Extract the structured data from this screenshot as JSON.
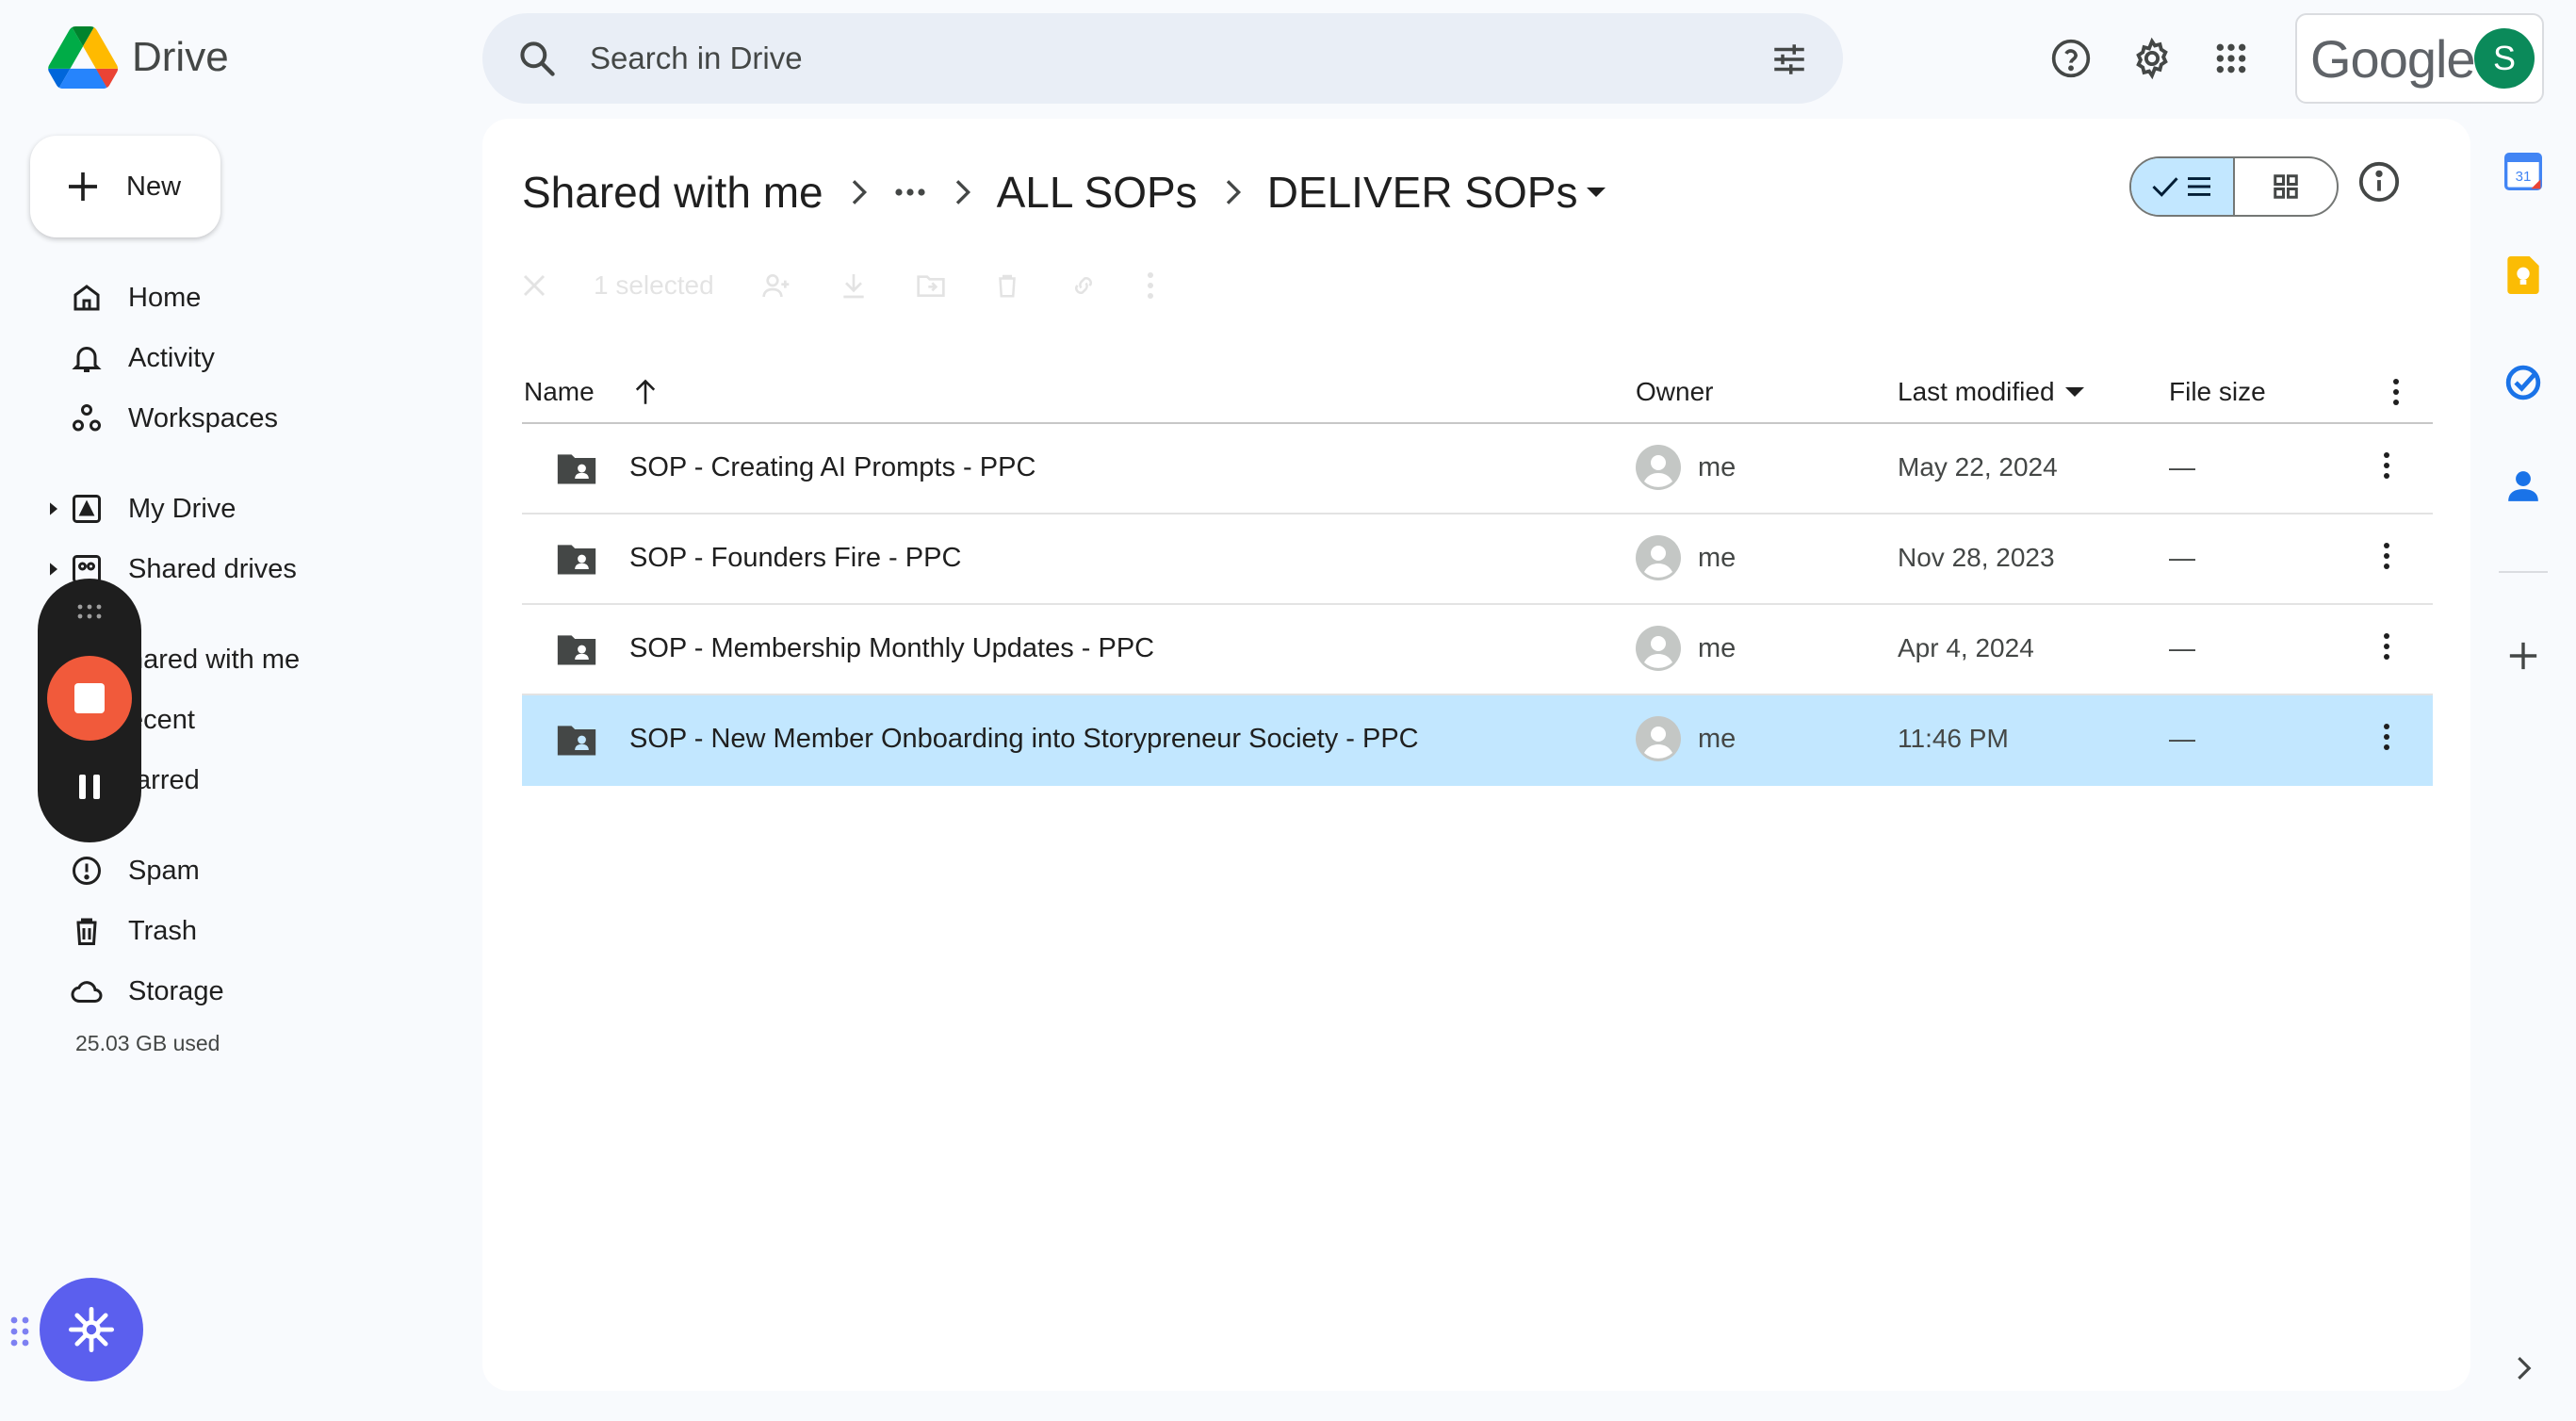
{
  "app": {
    "name": "Drive",
    "search_placeholder": "Search in Drive",
    "google_word": "Google",
    "avatar_letter": "S"
  },
  "sidebar": {
    "new_label": "New",
    "items": [
      {
        "label": "Home",
        "icon": "home-icon"
      },
      {
        "label": "Activity",
        "icon": "bell-icon"
      },
      {
        "label": "Workspaces",
        "icon": "workspaces-icon"
      },
      {
        "label": "My Drive",
        "icon": "my-drive-icon"
      },
      {
        "label": "Shared drives",
        "icon": "shared-drives-icon"
      },
      {
        "label": "hared with me",
        "icon": "shared-with-me-icon"
      },
      {
        "label": "ecent",
        "icon": "recent-icon"
      },
      {
        "label": "tarred",
        "icon": "starred-icon"
      },
      {
        "label": "Spam",
        "icon": "spam-icon"
      },
      {
        "label": "Trash",
        "icon": "trash-icon"
      },
      {
        "label": "Storage",
        "icon": "cloud-icon"
      }
    ],
    "storage_used": "25.03 GB used"
  },
  "breadcrumb": {
    "root": "Shared with me",
    "mid": "ALL SOPs",
    "current": "DELIVER SOPs"
  },
  "selection_bar": {
    "count": "1 selected"
  },
  "table": {
    "headers": {
      "name": "Name",
      "owner": "Owner",
      "modified": "Last modified",
      "size": "File size"
    },
    "rows": [
      {
        "name": "SOP - Creating AI Prompts - PPC",
        "owner": "me",
        "modified": "May 22, 2024",
        "size": "—",
        "selected": false
      },
      {
        "name": "SOP - Founders Fire - PPC",
        "owner": "me",
        "modified": "Nov 28, 2023",
        "size": "—",
        "selected": false
      },
      {
        "name": "SOP - Membership Monthly Updates - PPC",
        "owner": "me",
        "modified": "Apr 4, 2024",
        "size": "—",
        "selected": false
      },
      {
        "name": "SOP - New Member Onboarding into Storypreneur Society - PPC",
        "owner": "me",
        "modified": "11:46 PM",
        "size": "—",
        "selected": true
      }
    ]
  },
  "rail": {
    "calendar_day": "31"
  },
  "colors": {
    "accent_selected": "#c2e7ff",
    "record_button": "#f15a3b",
    "assistant_fab": "#5b5fee",
    "avatar_bg": "#0b8a5a"
  }
}
